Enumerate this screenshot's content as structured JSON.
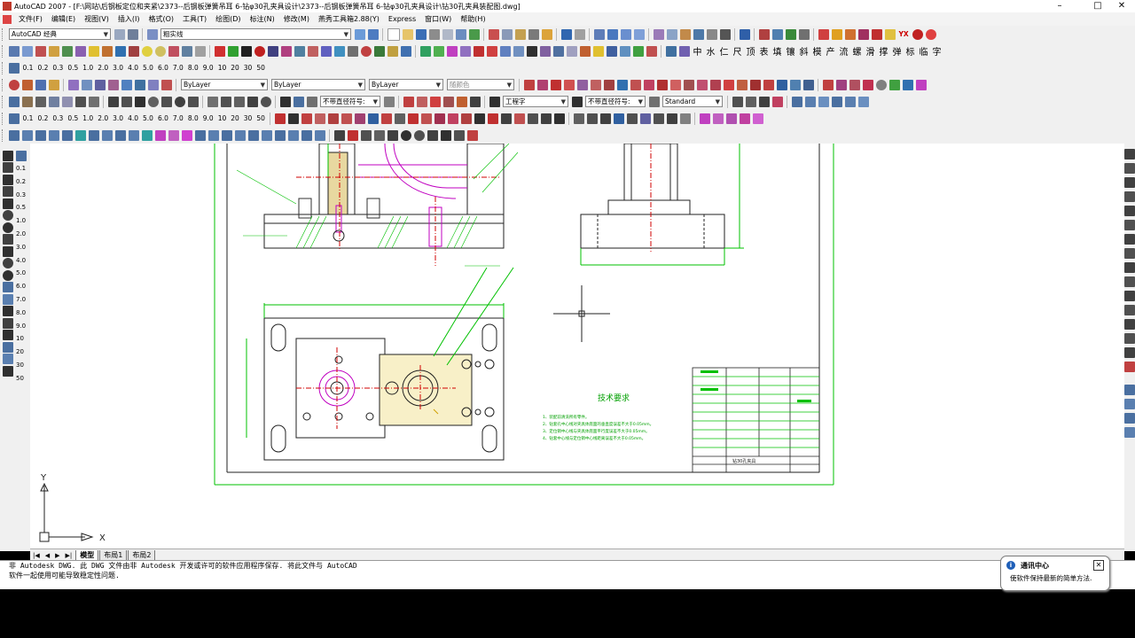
{
  "window": {
    "title": "AutoCAD 2007 - [F:\\网站\\后钢板定位和夹紧\\2373--后钢板弹簧吊耳 6-钻φ30孔夹具设计\\2373--后钢板弹簧吊耳 6-钻φ30孔夹具设计\\钻30孔夹具装配图.dwg]",
    "minimize": "–",
    "maximize": "□",
    "close": "✕"
  },
  "menu": [
    "文件(F)",
    "编辑(E)",
    "视图(V)",
    "插入(I)",
    "格式(O)",
    "工具(T)",
    "绘图(D)",
    "标注(N)",
    "修改(M)",
    "燕秀工具箱2.88(Y)",
    "Express",
    "窗口(W)",
    "帮助(H)"
  ],
  "toolbars": {
    "workspace": "AutoCAD 经典",
    "layer": "粗实线",
    "color": "ByLayer",
    "linetype": "ByLayer",
    "lineweight": "ByLayer",
    "plotstyle": "随颜色",
    "style1": "不带直径符号:",
    "textstyle": "工程字",
    "dimstyle": "不带直径符号:",
    "tablestyle": "Standard",
    "scales": [
      "0.1",
      "0.2",
      "0.3",
      "0.5",
      "1.0",
      "2.0",
      "3.0",
      "4.0",
      "5.0",
      "6.0",
      "7.0",
      "8.0",
      "9.0",
      "10",
      "20",
      "30",
      "50"
    ],
    "chinese_tools": [
      "中",
      "水",
      "仁",
      "尺",
      "顶",
      "表",
      "填",
      "镶",
      "斜",
      "模",
      "产",
      "流",
      "螺",
      "滑",
      "撑",
      "弹",
      "标",
      "临",
      "字"
    ],
    "yx_label": "YX"
  },
  "left_scale_values": [
    "0.1",
    "0.2",
    "0.3",
    "0.5",
    "1.0",
    "2.0",
    "3.0",
    "4.0",
    "5.0",
    "6.0",
    "7.0",
    "8.0",
    "9.0",
    "10",
    "20",
    "30",
    "50"
  ],
  "drawing": {
    "tech_title": "技术要求",
    "tech_lines": [
      "1、装配前清洗所有零件。",
      "2、钻套孔中心线对夹具体底面的垂直度误差不大于0.05mm。",
      "3、定位销中心线与夹具体底面平行度误差不大于0.05mm。",
      "4、钻套中心线与定位销中心线距离误差不大于0.05mm。"
    ],
    "title_block_name": "钻30孔夹具",
    "ucs_x": "X",
    "ucs_y": "Y"
  },
  "tabs": {
    "nav": [
      "|◀",
      "◀",
      "▶",
      "▶|"
    ],
    "items": [
      "模型",
      "布局1",
      "布局2"
    ],
    "active": 0
  },
  "command": {
    "line1": "非 Autodesk DWG.  此 DWG 文件由非 Autodesk 开发或许可的软件应用程序保存.  将此文件与 AutoCAD",
    "line2": "软件一起使用可能导致稳定性问题."
  },
  "notification": {
    "title": "通讯中心",
    "body": "使软件保持最新的简单方法.",
    "close": "✕"
  },
  "colors": {
    "toolbar_bg": "#f0f0f0",
    "canvas_bg": "#ffffff",
    "frame_green": "#00c000",
    "magenta": "#c000c0",
    "red": "#d00000",
    "drawing_black": "#202020"
  }
}
